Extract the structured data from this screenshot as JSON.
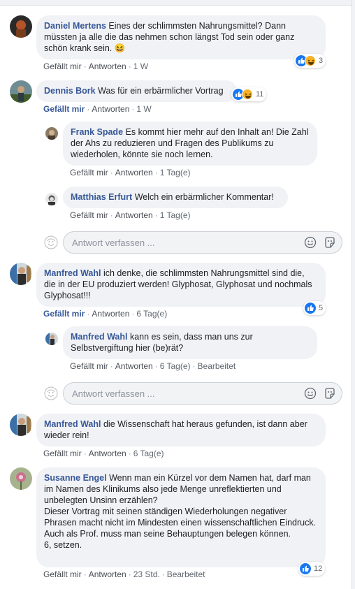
{
  "colors": {
    "link": "#385898",
    "bubble": "#f0f2f5",
    "like": "#1877f2",
    "haha": "#f7b125"
  },
  "comments": [
    {
      "name": "Daniel Mertens",
      "text": "Eines der schlimmsten Nahrungsmittel? Dann müssten ja alle die das nehmen schon längst Tod sein oder ganz schön krank sein. 😆",
      "like": "Gefällt mir",
      "reply": "Antworten",
      "time": "1 W",
      "reactions": "3"
    },
    {
      "name": "Dennis Bork",
      "text": "Was für ein erbärmlicher Vortrag",
      "like": "Gefällt mir",
      "reply": "Antworten",
      "time": "1 W",
      "reactions": "11",
      "replies": [
        {
          "name": "Frank Spade",
          "text": "Es kommt hier mehr auf den Inhalt an! Die Zahl der Ahs zu reduzieren und Fragen des Publikums zu wiederholen, könnte sie noch lernen.",
          "like": "Gefällt mir",
          "reply": "Antworten",
          "time": "1 Tag(e)"
        },
        {
          "name": "Matthias Erfurt",
          "text": "Welch ein erbärmlicher Kommentar!",
          "like": "Gefällt mir",
          "reply": "Antworten",
          "time": "1 Tag(e)"
        }
      ],
      "reply_placeholder": "Antwort verfassen ..."
    },
    {
      "name": "Manfred Wahl",
      "text": "ich denke, die schlimmsten Nahrungsmittel sind die, die in der EU produziert werden! Glyphosat, Glyphosat und nochmals Glyphosat!!!",
      "like": "Gefällt mir",
      "reply": "Antworten",
      "time": "6 Tag(e)",
      "reactions": "5",
      "replies": [
        {
          "name": "Manfred Wahl",
          "text": "kann es sein, dass man uns zur Selbstvergiftung hier (be)rät?",
          "like": "Gefällt mir",
          "reply": "Antworten",
          "time": "6 Tag(e)",
          "edited": "Bearbeitet"
        }
      ],
      "reply_placeholder": "Antwort verfassen ..."
    },
    {
      "name": "Manfred Wahl",
      "text": "die Wissenschaft hat heraus gefunden, ist dann aber wieder rein!",
      "like": "Gefällt mir",
      "reply": "Antworten",
      "time": "6 Tag(e)"
    },
    {
      "name": "Susanne Engel",
      "text_lines": [
        "Wenn man ein Kürzel vor dem Namen hat, darf man im Namen des Klinikums also jede Menge unreflektierten und unbelegten Unsinn erzählen?",
        "Dieser Vortrag mit seinen ständigen Wiederholungen negativer Phrasen macht nicht im Mindesten einen wissenschaftlichen Eindruck. Auch als Prof. muss man seine Behauptungen belegen können.",
        "6, setzen."
      ],
      "like": "Gefällt mir",
      "reply": "Antworten",
      "time": "23 Std.",
      "edited": "Bearbeitet",
      "reactions": "12"
    }
  ]
}
